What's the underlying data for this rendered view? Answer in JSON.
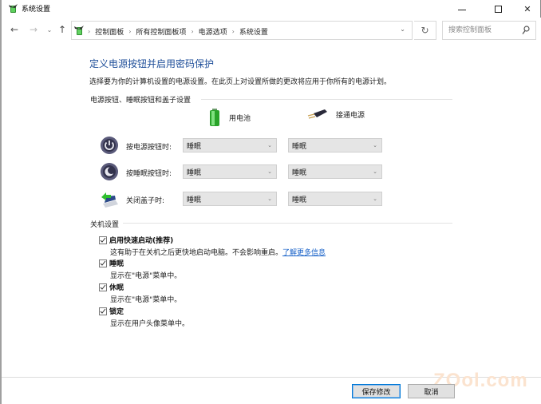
{
  "window": {
    "title": "系统设置",
    "icon": "power-options-icon",
    "controls": {
      "minimize": "minimize-icon",
      "maximize": "maximize-icon",
      "close": "✕"
    }
  },
  "nav": {
    "back": "←",
    "forward": "→",
    "recent": "⌄",
    "up": "↑",
    "breadcrumbs": [
      "控制面板",
      "所有控制面板项",
      "电源选项",
      "系统设置"
    ],
    "separator": "›",
    "dropdown": "⌄",
    "refresh": "↻",
    "search_placeholder": "搜索控制面板",
    "search_value": ""
  },
  "main": {
    "heading": "定义电源按钮并启用密码保护",
    "subtitle": "选择要为你的计算机设置的电源设置。在此页上对设置所做的更改将应用于你所有的电源计划。",
    "power_group": {
      "label": "电源按钮、睡眠按钮和盖子设置",
      "columns": [
        {
          "label": "用电池",
          "icon": "battery-icon"
        },
        {
          "label": "接通电源",
          "icon": "power-plug-icon"
        }
      ],
      "rows": [
        {
          "label": "按电源按钮时:",
          "icon": "power-button-icon",
          "battery": "睡眠",
          "plugged": "睡眠"
        },
        {
          "label": "按睡眠按钮时:",
          "icon": "sleep-button-icon",
          "battery": "睡眠",
          "plugged": "睡眠"
        },
        {
          "label": "关闭盖子时:",
          "icon": "laptop-lid-icon",
          "battery": "睡眠",
          "plugged": "睡眠"
        }
      ],
      "chevron": "⌄"
    },
    "shutdown_group": {
      "label": "关机设置",
      "items": [
        {
          "label": "启用快速启动(推荐)",
          "checked": true,
          "desc": "这有助于在关机之后更快地启动电脑。不会影响重启。",
          "link": "了解更多信息"
        },
        {
          "label": "睡眠",
          "checked": true,
          "desc": "显示在\"电源\"菜单中。"
        },
        {
          "label": "休眠",
          "checked": true,
          "desc": "显示在\"电源\"菜单中。"
        },
        {
          "label": "锁定",
          "checked": true,
          "desc": "显示在用户头像菜单中。"
        }
      ]
    }
  },
  "footer": {
    "save": "保存修改",
    "cancel": "取消"
  },
  "watermark": "ZOol.com",
  "colors": {
    "heading": "#1e4e99",
    "link": "#1a63c9",
    "primary_border": "#0078d7"
  }
}
